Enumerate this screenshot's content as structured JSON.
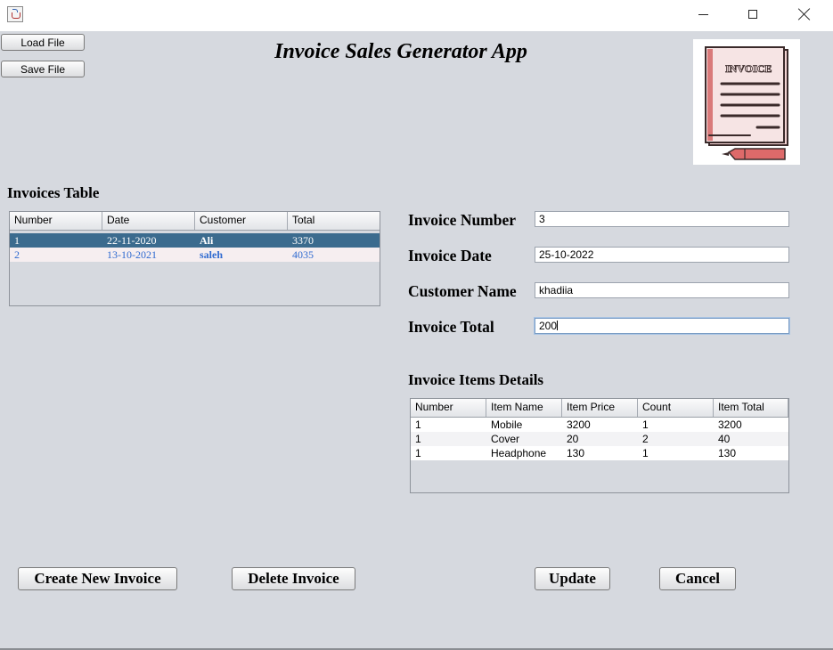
{
  "window": {
    "icon": "java-cup-icon",
    "controls": [
      "minimize",
      "maximize",
      "close"
    ]
  },
  "toolbar": {
    "load_label": "Load File",
    "save_label": "Save File"
  },
  "app_title": "Invoice Sales Generator App",
  "logo": {
    "text": "INVOICE",
    "icon": "invoice-document-icon"
  },
  "invoices_table": {
    "heading": "Invoices Table",
    "columns": [
      "Number",
      "Date",
      "Customer",
      "Total"
    ],
    "rows": [
      [
        "1",
        "22-11-2020",
        "Ali",
        "3370"
      ],
      [
        "2",
        "13-10-2021",
        "saleh",
        "4035"
      ]
    ],
    "selected_row": 0
  },
  "form": {
    "number_label": "Invoice Number",
    "number_value": "3",
    "date_label": "Invoice Date",
    "date_value": "25-10-2022",
    "customer_label": "Customer Name",
    "customer_value": "khadiia",
    "total_label": "Invoice Total",
    "total_value": "200"
  },
  "items_table": {
    "heading": "Invoice Items Details",
    "columns": [
      "Number",
      "Item Name",
      "Item Price",
      "Count",
      "Item Total"
    ],
    "rows": [
      [
        "1",
        "Mobile",
        "3200",
        "1",
        "3200"
      ],
      [
        "1",
        "Cover",
        "20",
        "2",
        "40"
      ],
      [
        "1",
        "Headphone",
        "130",
        "1",
        "130"
      ]
    ]
  },
  "actions": {
    "create_label": "Create New Invoice",
    "delete_label": "Delete Invoice",
    "update_label": "Update",
    "cancel_label": "Cancel"
  },
  "colors": {
    "background": "#d6d9df",
    "selection": "#3b6b8e",
    "alt_row_text": "#2f6ad0"
  }
}
